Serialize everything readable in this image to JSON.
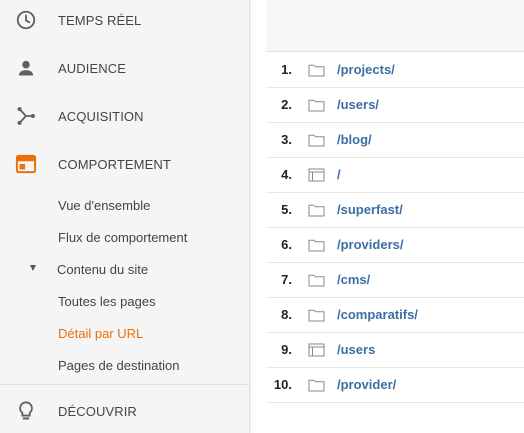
{
  "sidebar": {
    "items": [
      {
        "label": "TEMPS RÉEL",
        "icon": "clock-icon"
      },
      {
        "label": "AUDIENCE",
        "icon": "person-icon"
      },
      {
        "label": "ACQUISITION",
        "icon": "acquisition-icon"
      },
      {
        "label": "COMPORTEMENT",
        "icon": "behavior-icon"
      }
    ],
    "behavior_subitems": [
      {
        "label": "Vue d'ensemble"
      },
      {
        "label": "Flux de comportement"
      }
    ],
    "site_content": {
      "label": "Contenu du site",
      "children": [
        {
          "label": "Toutes les pages"
        },
        {
          "label": "Détail par URL",
          "selected": true
        },
        {
          "label": "Pages de destination"
        }
      ]
    },
    "discover": {
      "label": "DÉCOUVRIR",
      "icon": "lightbulb-icon"
    }
  },
  "colors": {
    "accent": "#e8710a",
    "link": "#3d6fa4",
    "icon_gray": "#616161"
  },
  "table": {
    "rows": [
      {
        "rank": "1.",
        "path": "/projects/",
        "icon": "folder-icon"
      },
      {
        "rank": "2.",
        "path": "/users/",
        "icon": "folder-icon"
      },
      {
        "rank": "3.",
        "path": "/blog/",
        "icon": "folder-icon"
      },
      {
        "rank": "4.",
        "path": "/",
        "icon": "page-icon"
      },
      {
        "rank": "5.",
        "path": "/superfast/",
        "icon": "folder-icon"
      },
      {
        "rank": "6.",
        "path": "/providers/",
        "icon": "folder-icon"
      },
      {
        "rank": "7.",
        "path": "/cms/",
        "icon": "folder-icon"
      },
      {
        "rank": "8.",
        "path": "/comparatifs/",
        "icon": "folder-icon"
      },
      {
        "rank": "9.",
        "path": "/users",
        "icon": "page-icon"
      },
      {
        "rank": "10.",
        "path": "/provider/",
        "icon": "folder-icon"
      }
    ]
  }
}
